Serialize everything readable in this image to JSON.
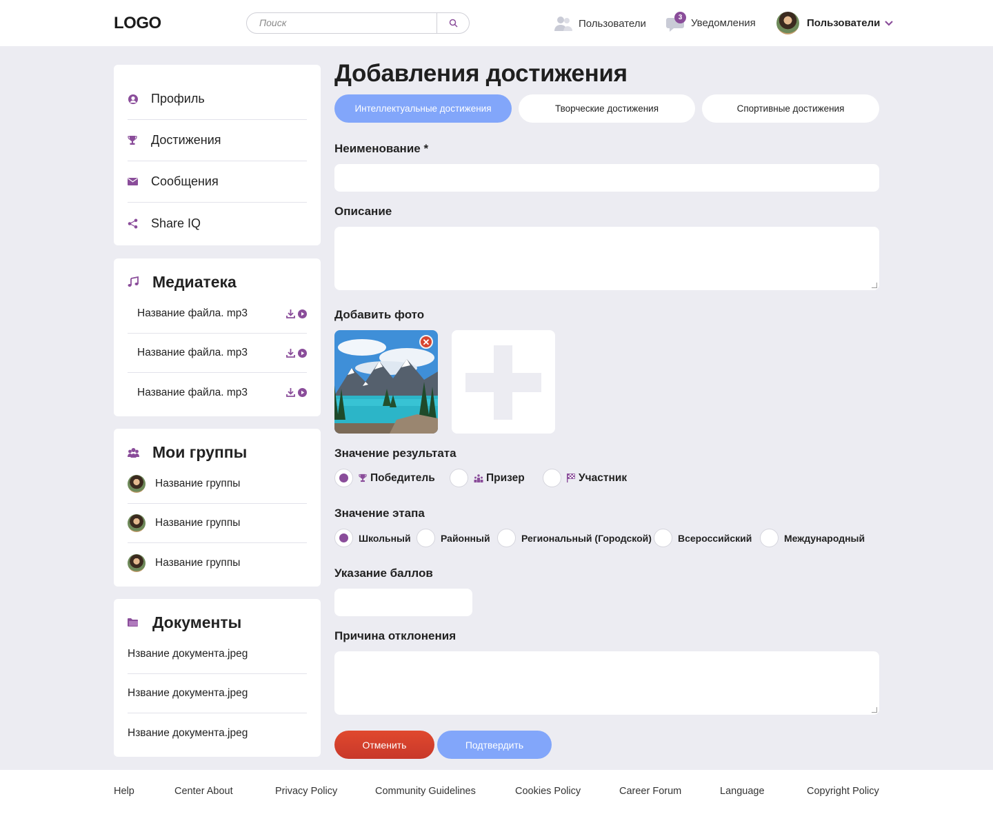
{
  "header": {
    "logo": "LOGO",
    "search_placeholder": "Поиск",
    "users_label": "Пользователи",
    "notifications_label": "Уведомления",
    "notifications_count": "3",
    "profile_name": "Пользователи"
  },
  "sidebar": {
    "menu": [
      {
        "label": "Профиль",
        "icon": "user-icon"
      },
      {
        "label": "Достижения",
        "icon": "trophy-icon"
      },
      {
        "label": "Сообщения",
        "icon": "envelope-icon"
      },
      {
        "label": "Share IQ",
        "icon": "share-icon"
      }
    ],
    "media": {
      "title": "Медиатека",
      "files": [
        "Название файла. mp3",
        "Название файла. mp3",
        "Название файла. mp3"
      ]
    },
    "groups": {
      "title": "Мои группы",
      "items": [
        "Название группы",
        "Название группы",
        "Название группы"
      ]
    },
    "documents": {
      "title": "Документы",
      "items": [
        "Нзвание документа.jpeg",
        "Нзвание документа.jpeg",
        "Нзвание документа.jpeg"
      ]
    }
  },
  "main": {
    "title": "Добавления достижения",
    "tabs": [
      {
        "label": "Интеллектуальные достижения",
        "active": true
      },
      {
        "label": "Творческие достижения",
        "active": false
      },
      {
        "label": "Спортивные достижения",
        "active": false
      }
    ],
    "name_label": "Неименование *",
    "name_value": "",
    "description_label": "Описание",
    "description_value": "",
    "photo_label": "Добавить фото",
    "result_label": "Значение результата",
    "result_options": [
      {
        "label": "Победитель",
        "icon": "trophy-icon",
        "selected": true
      },
      {
        "label": "Призер",
        "icon": "podium-icon",
        "selected": false
      },
      {
        "label": "Участник",
        "icon": "flag-icon",
        "selected": false
      }
    ],
    "stage_label": "Значение этапа",
    "stage_options": [
      {
        "label": "Школьный",
        "selected": true
      },
      {
        "label": "Районный",
        "selected": false
      },
      {
        "label": "Региональный (Городской)",
        "selected": false
      },
      {
        "label": "Всероссийский",
        "selected": false
      },
      {
        "label": "Международный",
        "selected": false
      }
    ],
    "points_label": "Указание баллов",
    "points_value": "",
    "reject_label": "Причина отклонения",
    "reject_value": "",
    "cancel_label": "Отменить",
    "confirm_label": "Подтвердить"
  },
  "footer": {
    "links": [
      "Help",
      "Center About",
      "Privacy Policy",
      "Community Guidelines",
      "Cookies Policy",
      "Career Forum",
      "Language",
      "Copyright Policy"
    ]
  },
  "colors": {
    "accent": "#8a4d9a",
    "primary_blue": "#82a6fa",
    "cancel_red": "#d6452f",
    "background": "#ececf2"
  }
}
